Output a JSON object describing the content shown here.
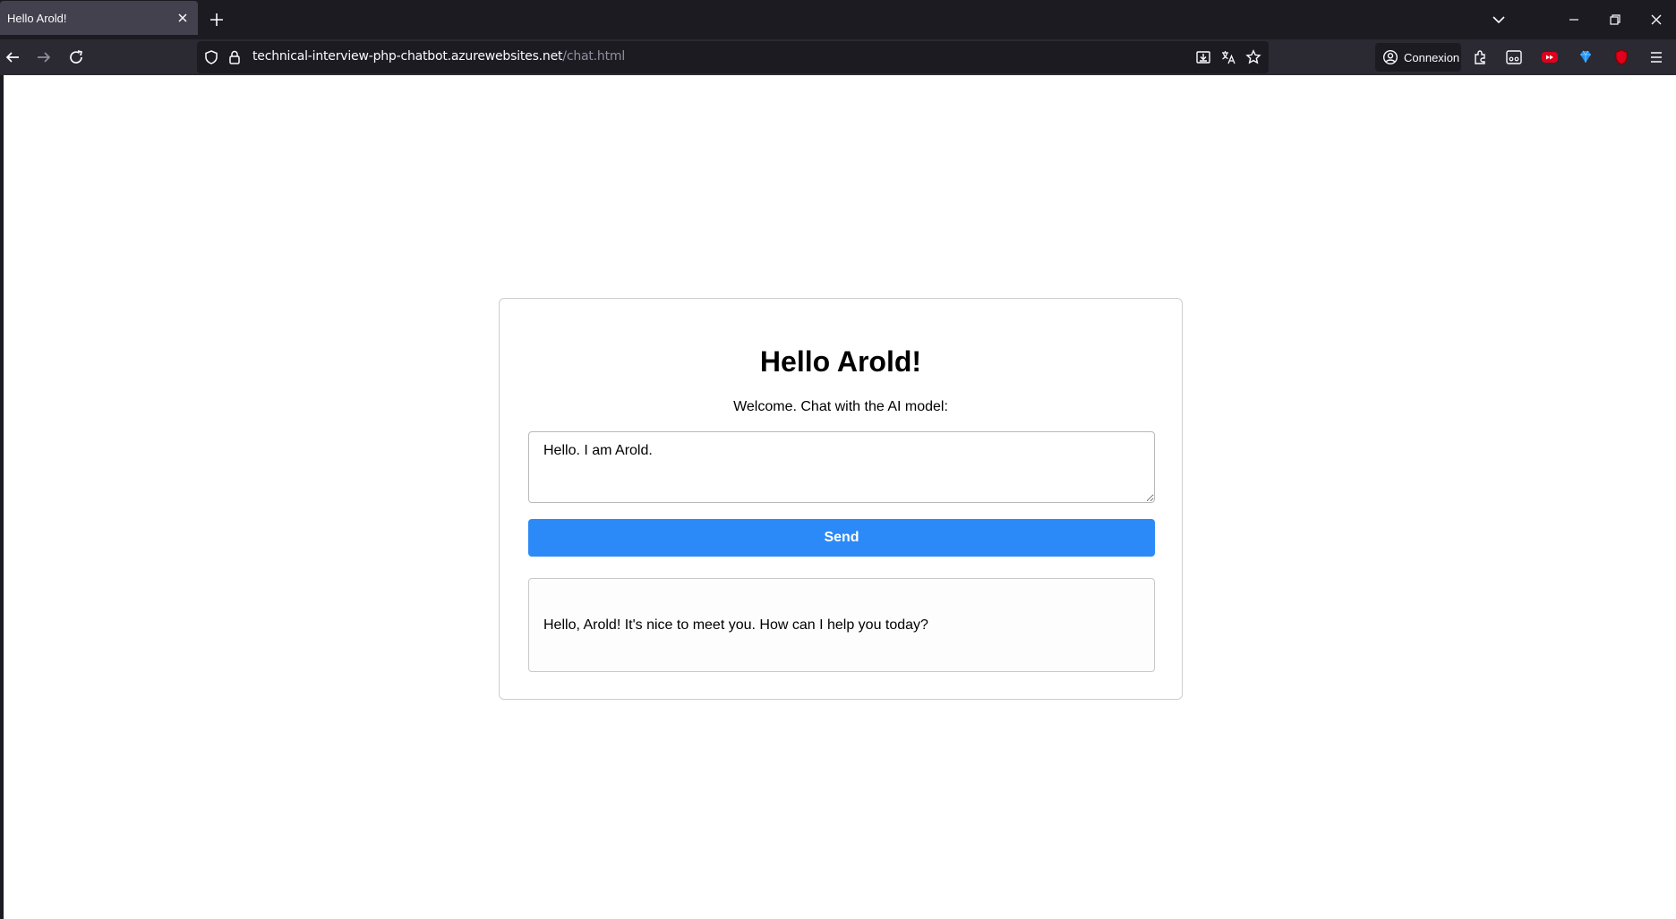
{
  "browser": {
    "tab": {
      "title": "Hello Arold!"
    },
    "url": {
      "host": "technical-interview-php-chatbot.azurewebsites.net",
      "path": "/chat.html"
    },
    "signin_label": "Connexion"
  },
  "icons": {
    "tab_close": "close-icon",
    "new_tab": "plus-icon",
    "tab_list": "chevron-down-icon",
    "minimize": "minimize-icon",
    "restore": "restore-icon",
    "close_window": "close-icon",
    "back": "back-arrow-icon",
    "forward": "forward-arrow-icon",
    "reload": "reload-icon",
    "tracking": "shield-icon",
    "lock": "lock-icon",
    "install": "install-icon",
    "translate": "translate-icon",
    "bookmark": "star-icon",
    "account": "account-icon",
    "extensions": "puzzle-icon",
    "reader": "reader-view-icon",
    "menu": "hamburger-menu-icon"
  },
  "page": {
    "title": "Hello Arold!",
    "subtitle": "Welcome. Chat with the AI model:",
    "input_value": "Hello. I am Arold.",
    "send_label": "Send",
    "response": "Hello, Arold! It's nice to meet you. How can I help you today?"
  },
  "colors": {
    "accent": "#2b8af7",
    "chrome_dark": "#1c1b22",
    "chrome_mid": "#2b2a33"
  }
}
